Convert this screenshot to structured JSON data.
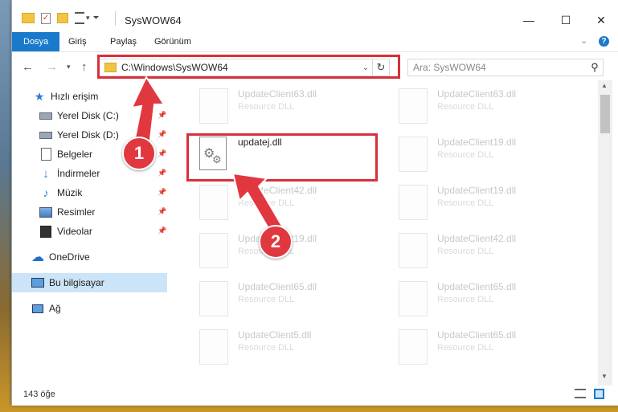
{
  "window": {
    "title": "SysWOW64",
    "controls": {
      "minimize": "—",
      "maximize": "☐",
      "close": "✕"
    }
  },
  "ribbon": {
    "tabs": [
      {
        "label": "Dosya",
        "active": true
      },
      {
        "label": "Giriş"
      },
      {
        "label": "Paylaş"
      },
      {
        "label": "Görünüm"
      }
    ],
    "expand_icon": "chevron-down-icon",
    "help_icon": "help-icon"
  },
  "address_bar": {
    "path": "C:\\Windows\\SysWOW64",
    "search_placeholder": "Ara: SysWOW64"
  },
  "sidebar": {
    "items": [
      {
        "label": "Hızlı erişim",
        "icon": "star-icon"
      },
      {
        "label": "Yerel Disk (C:)",
        "icon": "drive-icon",
        "pinned": true
      },
      {
        "label": "Yerel Disk (D:)",
        "icon": "drive-icon",
        "pinned": true
      },
      {
        "label": "Belgeler",
        "icon": "documents-icon",
        "pinned": true
      },
      {
        "label": "İndirmeler",
        "icon": "download-icon",
        "pinned": true
      },
      {
        "label": "Müzik",
        "icon": "music-icon",
        "pinned": true
      },
      {
        "label": "Resimler",
        "icon": "pictures-icon",
        "pinned": true
      },
      {
        "label": "Videolar",
        "icon": "video-icon",
        "pinned": true
      },
      {
        "label": "OneDrive",
        "icon": "cloud-icon"
      },
      {
        "label": "Bu bilgisayar",
        "icon": "computer-icon",
        "selected": true
      },
      {
        "label": "Ağ",
        "icon": "network-icon"
      }
    ]
  },
  "files": [
    {
      "name": "UpdateClient63.dll",
      "desc": "Resource DLL",
      "faded": true
    },
    {
      "name": "UpdateClient63.dll",
      "desc": "Resource DLL",
      "faded": true
    },
    {
      "name": "updatej.dll",
      "desc": "",
      "faded": false
    },
    {
      "name": "UpdateClient19.dll",
      "desc": "Resource DLL",
      "faded": true
    },
    {
      "name": "UpdateClient42.dll",
      "desc": "Resource DLL",
      "faded": true
    },
    {
      "name": "UpdateClient19.dll",
      "desc": "Resource DLL",
      "faded": true
    },
    {
      "name": "UpdateClient19.dll",
      "desc": "Resource DLL",
      "faded": true
    },
    {
      "name": "UpdateClient42.dll",
      "desc": "Resource DLL",
      "faded": true
    },
    {
      "name": "UpdateClient65.dll",
      "desc": "Resource DLL",
      "faded": true
    },
    {
      "name": "UpdateClient65.dll",
      "desc": "Resource DLL",
      "faded": true
    },
    {
      "name": "UpdateClient5.dll",
      "desc": "Resource DLL",
      "faded": true
    },
    {
      "name": "UpdateClient65.dll",
      "desc": "Resource DLL",
      "faded": true
    }
  ],
  "status": {
    "count": "143 öğe"
  },
  "annotations": {
    "step1": "1",
    "step2": "2",
    "color": "#e1383f"
  }
}
